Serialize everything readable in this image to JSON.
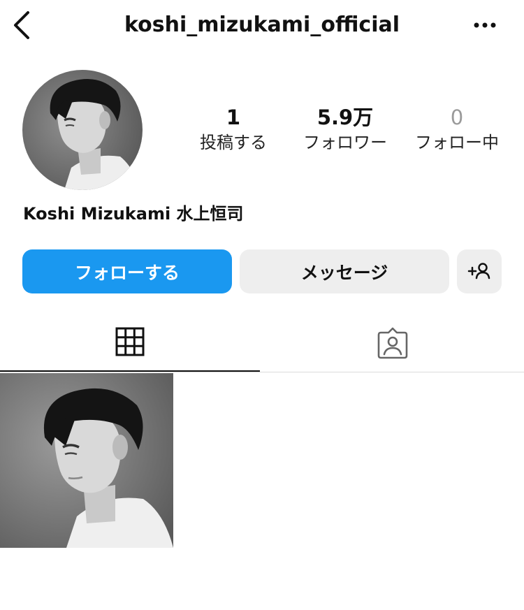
{
  "header": {
    "username": "koshi_mizukami_official",
    "back_icon": "chevron-left-icon",
    "more_icon": "more-horizontal-icon"
  },
  "profile": {
    "display_name": "Koshi Mizukami 水上恒司",
    "stats": [
      {
        "value": "1",
        "label": "投稿する"
      },
      {
        "value": "5.9万",
        "label": "フォロワー"
      },
      {
        "value": "0",
        "label": "フォロー中"
      }
    ]
  },
  "actions": {
    "follow_label": "フォローする",
    "message_label": "メッセージ",
    "add_user_icon": "add-user-icon"
  },
  "tabs": [
    {
      "icon": "grid-icon",
      "active": true
    },
    {
      "icon": "tagged-icon",
      "active": false
    }
  ],
  "colors": {
    "follow_button": "#1a98f0",
    "secondary_button": "#eeeeee",
    "muted_text": "#9a9a9a",
    "divider": "#dbdbdb"
  },
  "posts": [
    {
      "type": "photo",
      "description_icon": "portrait-photo"
    }
  ]
}
